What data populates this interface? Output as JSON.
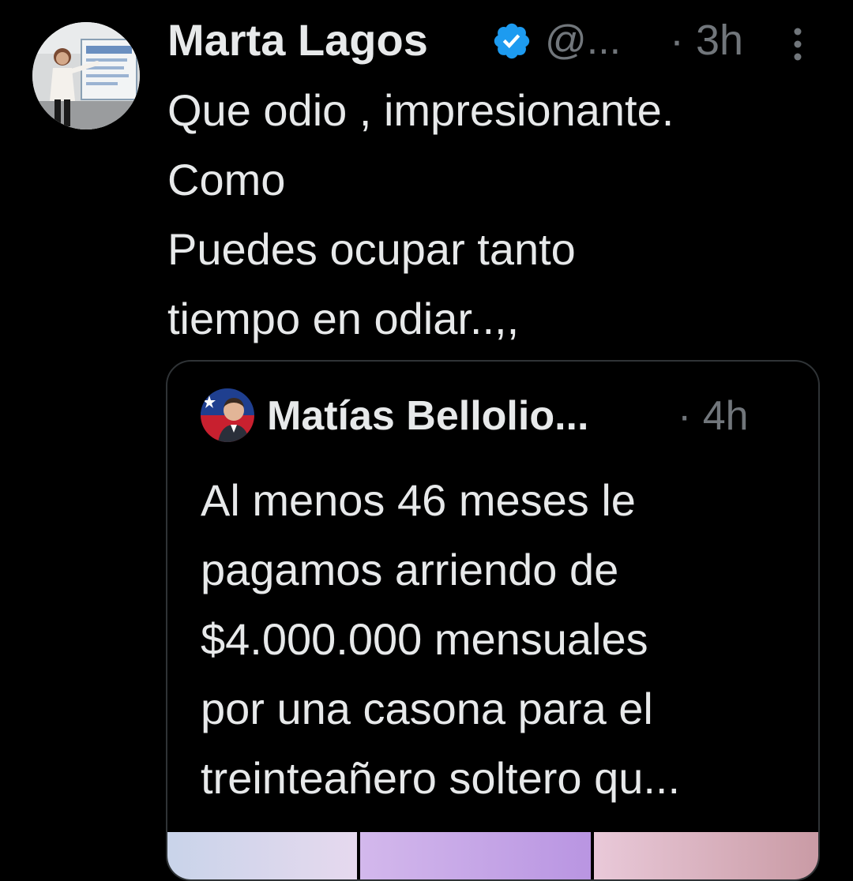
{
  "tweet": {
    "author_name": "Marta Lagos",
    "handle": "@...",
    "time": "· 3h",
    "lines": [
      "Que odio , impresionante.",
      "Como",
      "Puedes ocupar tanto",
      "tiempo en odiar..,,"
    ]
  },
  "quoted_tweet": {
    "author_name": "Matías Bellolio...",
    "time": "· 4h",
    "lines": [
      "Al menos 46 meses le",
      "pagamos arriendo de",
      "$4.000.000 mensuales",
      "por una casona para el",
      "treinteañero soltero qu..."
    ]
  },
  "icons": {
    "verified": "verified-badge-icon",
    "more": "more-options-icon"
  },
  "colors": {
    "background": "#000000",
    "text_primary": "#e7e9ea",
    "text_secondary": "#71767b",
    "verified": "#1d9bf0",
    "card_border": "#2f3336"
  }
}
